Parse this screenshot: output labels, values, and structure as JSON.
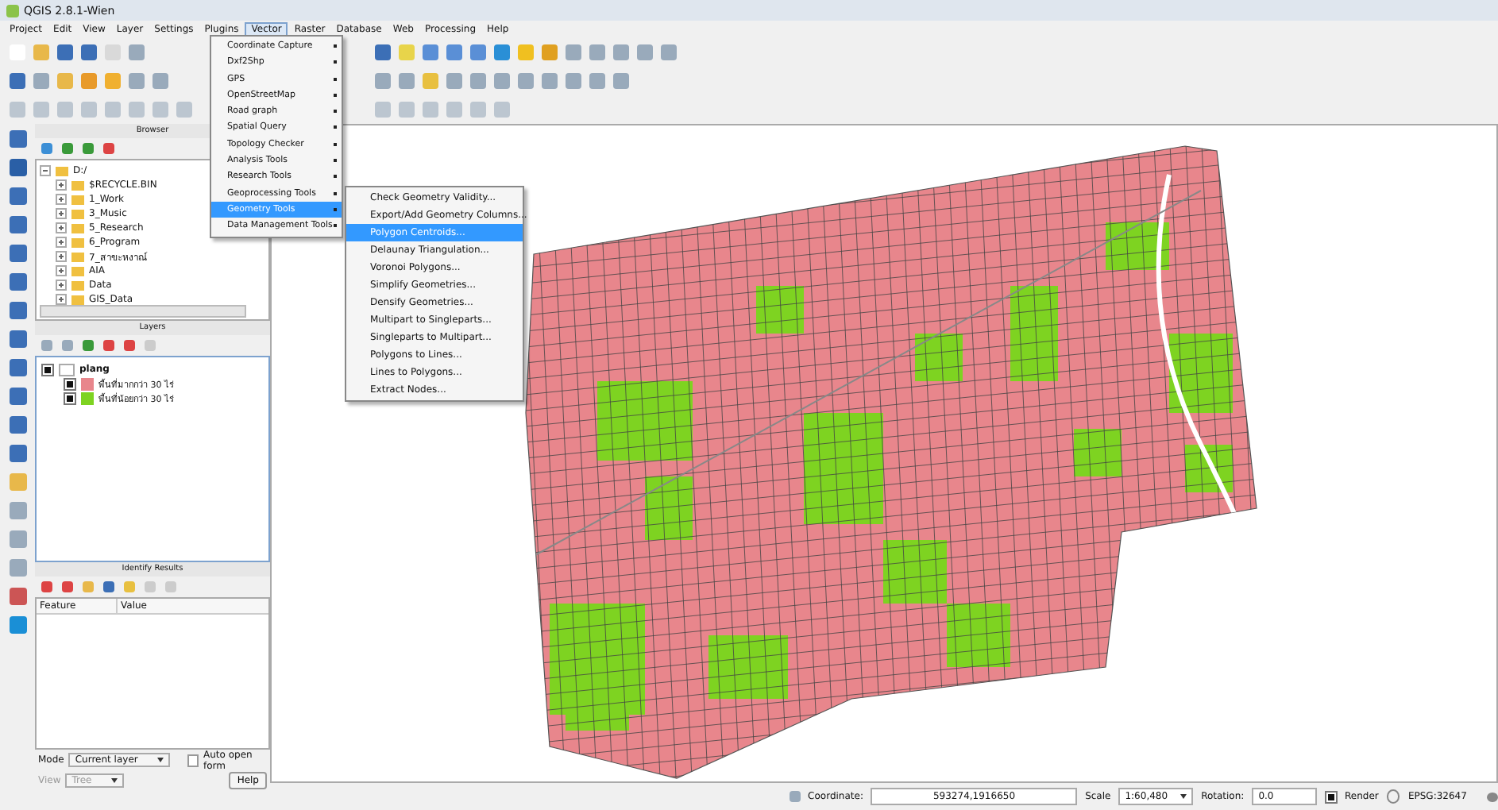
{
  "window": {
    "title": "QGIS 2.8.1-Wien"
  },
  "menu_bar": [
    {
      "label": "Project",
      "selected": false
    },
    {
      "label": "Edit",
      "selected": false
    },
    {
      "label": "View",
      "selected": false
    },
    {
      "label": "Layer",
      "selected": false
    },
    {
      "label": "Settings",
      "selected": false
    },
    {
      "label": "Plugins",
      "selected": false
    },
    {
      "label": "Vector",
      "selected": true
    },
    {
      "label": "Raster",
      "selected": false
    },
    {
      "label": "Database",
      "selected": false
    },
    {
      "label": "Web",
      "selected": false
    },
    {
      "label": "Processing",
      "selected": false
    },
    {
      "label": "Help",
      "selected": false
    }
  ],
  "vector_menu": [
    {
      "label": "Coordinate Capture",
      "selected": false
    },
    {
      "label": "Dxf2Shp",
      "selected": false
    },
    {
      "label": "GPS",
      "selected": false
    },
    {
      "label": "OpenStreetMap",
      "selected": false
    },
    {
      "label": "Road graph",
      "selected": false
    },
    {
      "label": "Spatial Query",
      "selected": false
    },
    {
      "label": "Topology Checker",
      "selected": false
    },
    {
      "label": "Analysis Tools",
      "selected": false
    },
    {
      "label": "Research Tools",
      "selected": false
    },
    {
      "label": "Geoprocessing Tools",
      "selected": false
    },
    {
      "label": "Geometry Tools",
      "selected": true
    },
    {
      "label": "Data Management Tools",
      "selected": false
    }
  ],
  "geometry_submenu": [
    {
      "label": "Check Geometry Validity...",
      "selected": false
    },
    {
      "label": "Export/Add Geometry Columns...",
      "selected": false
    },
    {
      "label": "Polygon Centroids...",
      "selected": true
    },
    {
      "label": "Delaunay Triangulation...",
      "selected": false
    },
    {
      "label": "Voronoi Polygons...",
      "selected": false
    },
    {
      "label": "Simplify Geometries...",
      "selected": false
    },
    {
      "label": "Densify Geometries...",
      "selected": false
    },
    {
      "label": "Multipart to Singleparts...",
      "selected": false
    },
    {
      "label": "Singleparts to Multipart...",
      "selected": false
    },
    {
      "label": "Polygons to Lines...",
      "selected": false
    },
    {
      "label": "Lines to Polygons...",
      "selected": false
    },
    {
      "label": "Extract Nodes...",
      "selected": false
    }
  ],
  "browser": {
    "title": "Browser",
    "tree": [
      {
        "label": "D:/",
        "expanded": true,
        "children": [
          {
            "label": "$RECYCLE.BIN"
          },
          {
            "label": "1_Work"
          },
          {
            "label": "3_Music"
          },
          {
            "label": "5_Research"
          },
          {
            "label": "6_Program"
          },
          {
            "label": "7_สาขะหงาณ์"
          },
          {
            "label": "AIA"
          },
          {
            "label": "Data"
          },
          {
            "label": "GIS_Data"
          }
        ]
      }
    ]
  },
  "layers": {
    "title": "Layers",
    "tree": [
      {
        "label": "plang",
        "checked": true,
        "children": [
          {
            "label": "พื้นที่มากกว่า 30 ไร่",
            "checked": true,
            "color": "#e8868c"
          },
          {
            "label": "พื้นที่น้อยกว่า 30 ไร่",
            "checked": true,
            "color": "#7ed321"
          }
        ]
      }
    ]
  },
  "identify": {
    "title": "Identify Results",
    "columns": [
      "Feature",
      "Value"
    ],
    "mode_label": "Mode",
    "mode": "Current layer",
    "auto_open_form": {
      "label": "Auto open form",
      "checked": false
    },
    "view_label": "View",
    "view": "Tree",
    "help": "Help"
  },
  "status_bar": {
    "coordinate_label": "Coordinate:",
    "coordinate": "593274,1916650",
    "scale_label": "Scale",
    "scale": "1:60,480",
    "rotation_label": "Rotation:",
    "rotation": "0.0",
    "render": {
      "label": "Render",
      "checked": true
    },
    "crs": "EPSG:32647"
  }
}
